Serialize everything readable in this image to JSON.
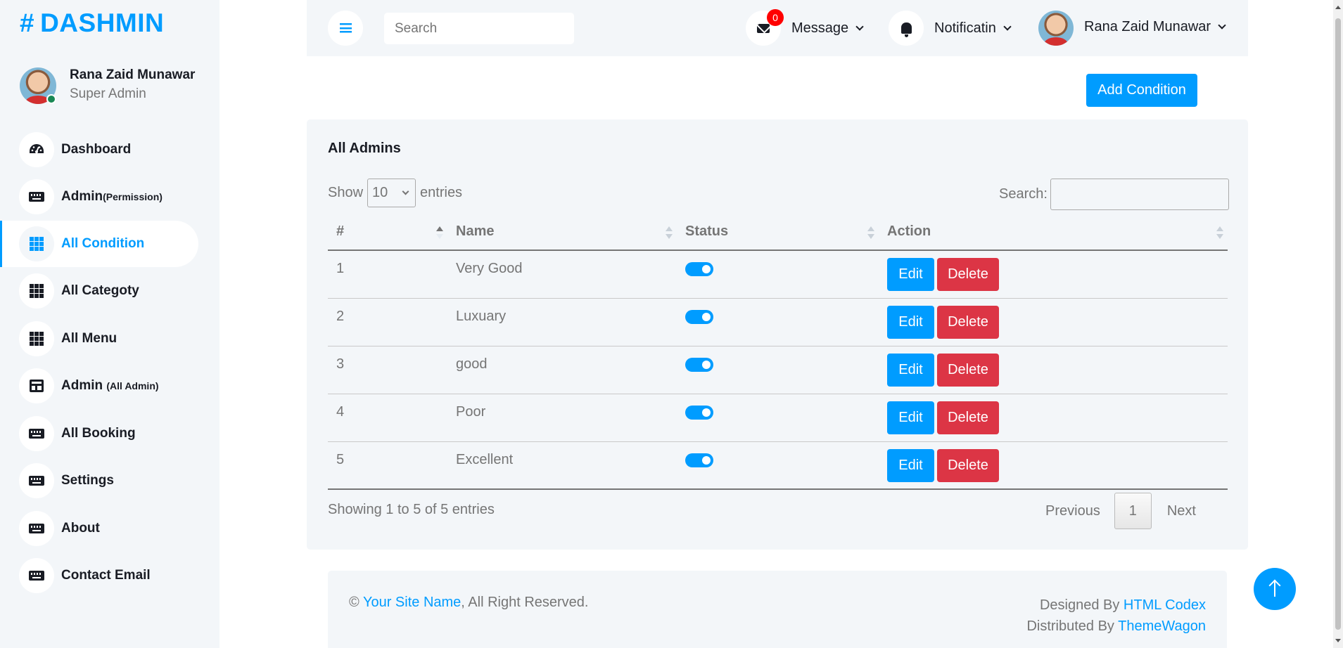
{
  "brand": {
    "hash": "#",
    "name": "DASHMIN"
  },
  "profile": {
    "name": "Rana Zaid Munawar",
    "role": "Super Admin"
  },
  "sidebar": {
    "items": [
      {
        "label": "Dashboard",
        "sub": "",
        "icon": "gauge-icon"
      },
      {
        "label": "Admin",
        "sub": "(Permission)",
        "icon": "keyboard-icon"
      },
      {
        "label": "All Condition",
        "sub": "",
        "icon": "grid-icon",
        "active": true
      },
      {
        "label": "All Categoty",
        "sub": "",
        "icon": "grid-icon"
      },
      {
        "label": "All Menu",
        "sub": "",
        "icon": "grid-icon"
      },
      {
        "label": "Admin ",
        "sub": "(All Admin)",
        "icon": "table-icon"
      },
      {
        "label": "All Booking",
        "sub": "",
        "icon": "keyboard-icon"
      },
      {
        "label": "Settings",
        "sub": "",
        "icon": "keyboard-icon"
      },
      {
        "label": "About",
        "sub": "",
        "icon": "keyboard-icon"
      },
      {
        "label": "Contact Email",
        "sub": "",
        "icon": "keyboard-icon"
      }
    ]
  },
  "topbar": {
    "search_placeholder": "Search",
    "message_count": "0",
    "message_label": "Message",
    "notification_label": "Notificatin",
    "user_name": "Rana Zaid Munawar"
  },
  "actions": {
    "add_condition": "Add Condition"
  },
  "table_card": {
    "title": "All Admins",
    "show_label": "Show",
    "page_size": "10",
    "entries_label": "entries",
    "search_label": "Search:",
    "columns": [
      "#",
      "Name",
      "Status",
      "Action"
    ],
    "rows": [
      {
        "num": "1",
        "name": "Very Good",
        "status": true
      },
      {
        "num": "2",
        "name": "Luxuary",
        "status": true
      },
      {
        "num": "3",
        "name": "good",
        "status": true
      },
      {
        "num": "4",
        "name": "Poor",
        "status": true
      },
      {
        "num": "5",
        "name": "Excellent",
        "status": true
      }
    ],
    "edit_label": "Edit",
    "delete_label": "Delete",
    "info": "Showing 1 to 5 of 5 entries",
    "pagination": {
      "previous": "Previous",
      "current": "1",
      "next": "Next"
    }
  },
  "footer": {
    "copyright_symbol": "©",
    "site_name": "Your Site Name",
    "rights": ", All Right Reserved.",
    "designed_by": "Designed By ",
    "designer": "HTML Codex",
    "distributed_by": "Distributed By ",
    "distributor": "ThemeWagon"
  },
  "colors": {
    "accent": "#009cff",
    "danger": "#dc3545",
    "panel": "#f3f6f9",
    "badge": "#ff0000"
  }
}
